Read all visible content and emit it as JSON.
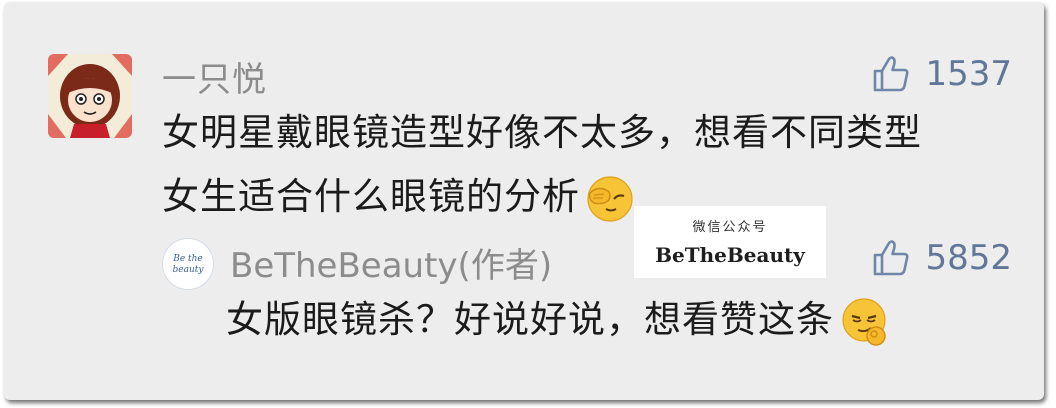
{
  "comment": {
    "author": "一只悦",
    "like_count": "1537",
    "text_line1": "女明星戴眼镜造型好像不太多，想看不同类型",
    "text_line2": "女生适合什么眼镜的分析"
  },
  "reply": {
    "author": "BeTheBeauty(作者)",
    "avatar_text_line1": "Be the",
    "avatar_text_line2": "beauty",
    "like_count": "5852",
    "text": "女版眼镜杀？好说好说，想看赞这条"
  },
  "watermark": {
    "line1": "微信公众号",
    "line2": "BeTheBeauty"
  },
  "icons": {
    "like": "thumbs-up-icon",
    "emoji1": "facepalm-emoji-icon",
    "emoji2": "smirk-ok-emoji-icon"
  },
  "colors": {
    "background": "#ededed",
    "name": "#8c8c8c",
    "like": "#61779a",
    "text": "#1b1b1b"
  }
}
